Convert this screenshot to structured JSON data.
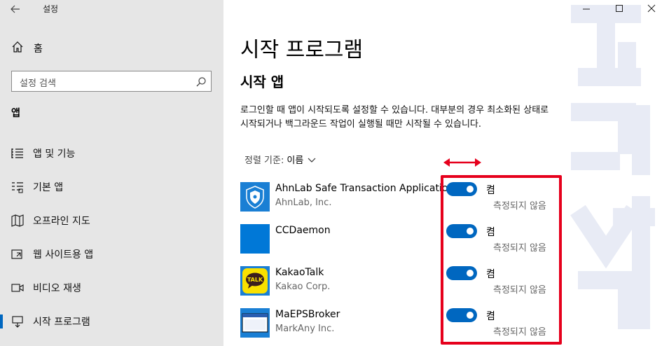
{
  "window": {
    "title": "설정"
  },
  "sidebar": {
    "home_label": "홈",
    "search_placeholder": "설정 검색",
    "section_label": "앱",
    "items": [
      {
        "label": "앱 및 기능",
        "icon": "apps-list-icon"
      },
      {
        "label": "기본 앱",
        "icon": "default-apps-icon"
      },
      {
        "label": "오프라인 지도",
        "icon": "map-icon"
      },
      {
        "label": "웹 사이트용 앱",
        "icon": "web-app-icon"
      },
      {
        "label": "비디오 재생",
        "icon": "video-icon"
      },
      {
        "label": "시작 프로그램",
        "icon": "startup-icon",
        "active": true
      }
    ]
  },
  "main": {
    "title": "시작 프로그램",
    "subtitle": "시작 앱",
    "description": "로그인할 때 앱이 시작되도록 설정할 수 있습니다. 대부분의 경우 최소화된 상태로 시작되거나 백그라운드 작업이 실행될 때만 시작될 수 있습니다.",
    "sort_label": "정렬 기준:",
    "sort_value": "이름",
    "apps": [
      {
        "name": "AhnLab Safe Transaction Application",
        "publisher": "AhnLab, Inc.",
        "state": "켬",
        "impact": "측정되지 않음",
        "on": true,
        "icon": "ahnlab-shield-icon"
      },
      {
        "name": "CCDaemon",
        "publisher": "",
        "state": "켬",
        "impact": "측정되지 않음",
        "on": true,
        "icon": "blue-square-icon"
      },
      {
        "name": "KakaoTalk",
        "publisher": "Kakao Corp.",
        "state": "켬",
        "impact": "측정되지 않음",
        "on": true,
        "icon": "kakaotalk-icon"
      },
      {
        "name": "MaEPSBroker",
        "publisher": "MarkAny Inc.",
        "state": "켬",
        "impact": "측정되지 않음",
        "on": true,
        "icon": "maeps-window-icon"
      }
    ],
    "kakao_badge": "TALK"
  },
  "colors": {
    "accent": "#0067c0",
    "highlight": "#e6001c",
    "sidebar_bg": "#e6e6e6"
  }
}
